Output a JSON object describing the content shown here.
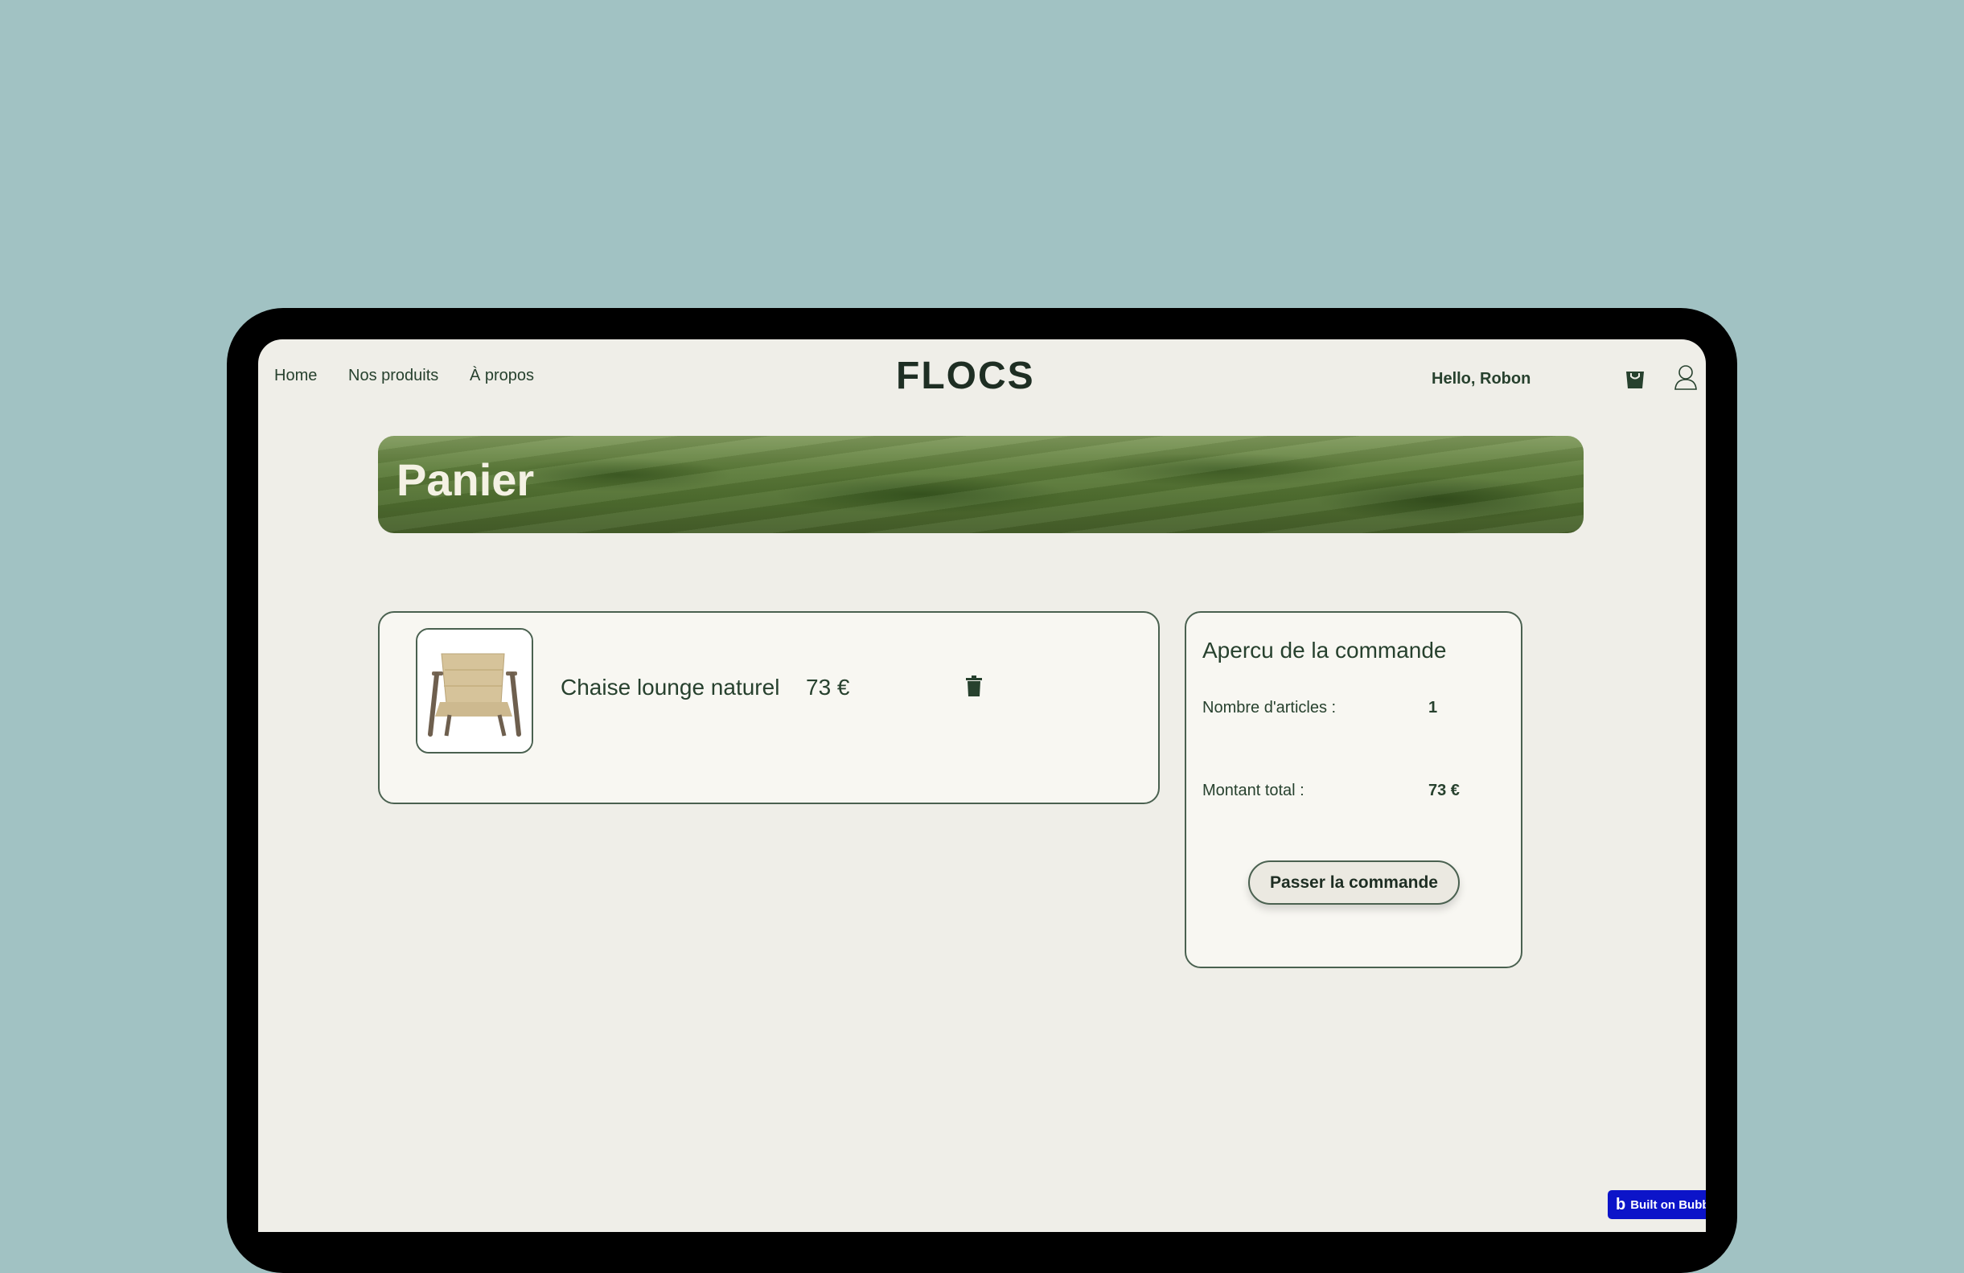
{
  "nav": {
    "links": [
      "Home",
      "Nos produits",
      "À propos"
    ],
    "logo": "FLOCS",
    "greeting": "Hello, Robon"
  },
  "icons": {
    "bag": "shopping-bag-icon",
    "user": "user-icon",
    "trash": "trash-icon"
  },
  "banner": {
    "title": "Panier"
  },
  "cart": {
    "items": [
      {
        "name": "Chaise lounge naturel",
        "price": "73 €"
      }
    ]
  },
  "summary": {
    "title": "Apercu de la commande",
    "count_label": "Nombre d'articles :",
    "count_value": "1",
    "total_label": "Montant total :",
    "total_value": "73 €",
    "button": "Passer la commande"
  },
  "badge": {
    "label": "Built on Bubble"
  },
  "colors": {
    "accent": "#27412e",
    "background": "#a1c2c3",
    "page": "#efeee8"
  }
}
